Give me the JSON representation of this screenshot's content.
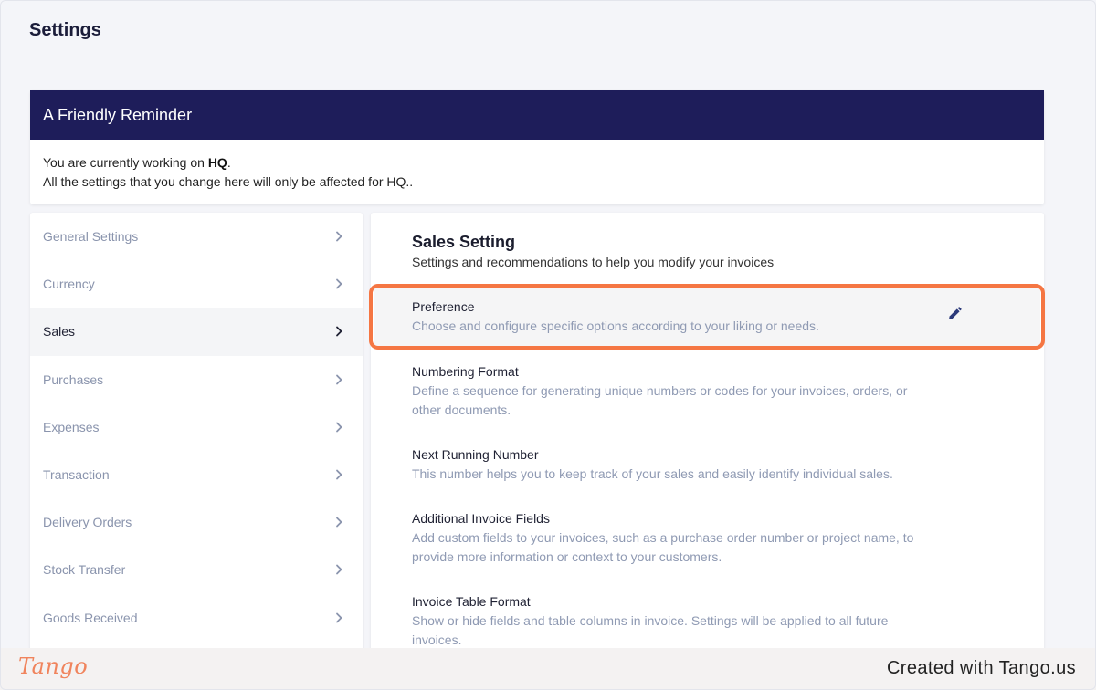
{
  "page": {
    "title": "Settings"
  },
  "reminder": {
    "title": "A Friendly Reminder",
    "line1_prefix": "You are currently working on ",
    "line1_branch": "HQ",
    "line1_suffix": ".",
    "line2": "All the settings that you change here will only be affected for HQ.."
  },
  "sidebar": {
    "items": [
      {
        "label": "General Settings",
        "active": false
      },
      {
        "label": "Currency",
        "active": false
      },
      {
        "label": "Sales",
        "active": true
      },
      {
        "label": "Purchases",
        "active": false
      },
      {
        "label": "Expenses",
        "active": false
      },
      {
        "label": "Transaction",
        "active": false
      },
      {
        "label": "Delivery Orders",
        "active": false
      },
      {
        "label": "Stock Transfer",
        "active": false
      },
      {
        "label": "Goods Received",
        "active": false
      }
    ]
  },
  "main": {
    "title": "Sales Setting",
    "subtitle": "Settings and recommendations to help you modify your invoices",
    "options": [
      {
        "title": "Preference",
        "desc": "Choose and configure specific options according to your liking or needs."
      },
      {
        "title": "Numbering Format",
        "desc": "Define a sequence for generating unique numbers or codes for your invoices, orders, or other documents."
      },
      {
        "title": "Next Running Number",
        "desc": "This number helps you to keep track of your sales and easily identify individual sales."
      },
      {
        "title": "Additional Invoice Fields",
        "desc": "Add custom fields to your invoices, such as a purchase order number or project name, to provide more information or context to your customers."
      },
      {
        "title": "Invoice Table Format",
        "desc": "Show or hide fields and table columns in invoice. Settings will be applied to all future invoices."
      }
    ]
  },
  "footer": {
    "logo": "Tango",
    "credit": "Created with Tango.us"
  },
  "colors": {
    "header": "#1e1d5a",
    "highlight": "#f57643",
    "muted": "#8f9ab3",
    "logo": "#f0845d"
  },
  "icons": {
    "chevron": "chevron-right-icon",
    "edit": "pencil-icon"
  }
}
